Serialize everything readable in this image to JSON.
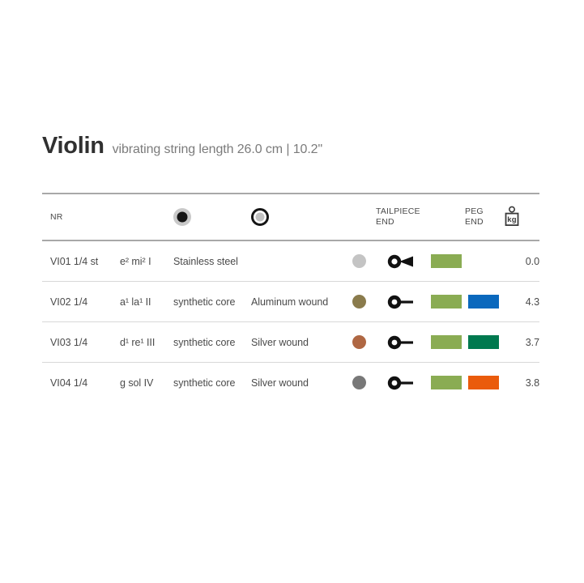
{
  "header": {
    "instrument": "Violin",
    "subtitle": "vibrating string length 26.0 cm | 10.2\""
  },
  "table": {
    "columns": {
      "nr": "NR",
      "note": "",
      "core": "",
      "wound": "",
      "dot": "",
      "tailpiece_end_line1": "TAILPIECE",
      "tailpiece_end_line2": "END",
      "peg_end_line1": "PEG",
      "peg_end_line2": "END",
      "weight_unit": "kg"
    },
    "header_icons": {
      "ball_end": "ball-end-icon",
      "loop_end": "loop-end-icon",
      "weight": "weight-kg-icon"
    },
    "rows": [
      {
        "nr": "VI01 1/4 st",
        "note": "e²  mi²  I",
        "core": "Stainless steel",
        "wound": "",
        "dot_color": "#c4c4c4",
        "end_type": "loop-end-icon",
        "peg_color_1": "#8aac53",
        "peg_color_2": "",
        "tension": "0.0"
      },
      {
        "nr": "VI02 1/4",
        "note": "a¹  la¹  II",
        "core": "synthetic core",
        "wound": "Aluminum wound",
        "dot_color": "#8a7b4c",
        "end_type": "ball-end-icon",
        "peg_color_1": "#8aac53",
        "peg_color_2": "#0a68bd",
        "tension": "4.3"
      },
      {
        "nr": "VI03 1/4",
        "note": "d¹  re¹  III",
        "core": "synthetic core",
        "wound": "Silver wound",
        "dot_color": "#af6743",
        "end_type": "ball-end-icon",
        "peg_color_1": "#8aac53",
        "peg_color_2": "#00794f",
        "tension": "3.7"
      },
      {
        "nr": "VI04 1/4",
        "note": "g  sol  IV",
        "core": "synthetic core",
        "wound": "Silver wound",
        "dot_color": "#787878",
        "end_type": "ball-end-icon",
        "peg_color_1": "#8aac53",
        "peg_color_2": "#ea5b0c",
        "tension": "3.8"
      }
    ]
  }
}
